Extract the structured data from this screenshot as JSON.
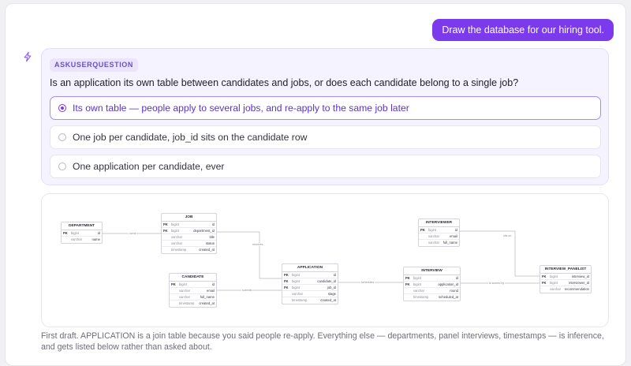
{
  "user_message": "Draw the database for our hiring tool.",
  "question": {
    "tool_label": "ASKUSERQUESTION",
    "text": "Is an application its own table between candidates and jobs, or does each candidate belong to a single job?",
    "options": [
      {
        "label": "Its own table — people apply to several jobs, and re-apply to the same job later",
        "selected": true
      },
      {
        "label": "One job per candidate, job_id sits on the candidate row",
        "selected": false
      },
      {
        "label": "One application per candidate, ever",
        "selected": false
      }
    ]
  },
  "diagram": {
    "tables": {
      "department": {
        "name": "DEPARTMENT",
        "rows": [
          {
            "key": "PK",
            "type": "bigint",
            "field": "id"
          },
          {
            "key": "",
            "type": "varchar",
            "field": "name"
          }
        ]
      },
      "job": {
        "name": "JOB",
        "rows": [
          {
            "key": "PK",
            "type": "bigint",
            "field": "id"
          },
          {
            "key": "FK",
            "type": "bigint",
            "field": "department_id"
          },
          {
            "key": "",
            "type": "varchar",
            "field": "title"
          },
          {
            "key": "",
            "type": "varchar",
            "field": "status"
          },
          {
            "key": "",
            "type": "timestamp",
            "field": "created_at"
          }
        ]
      },
      "candidate": {
        "name": "CANDIDATE",
        "rows": [
          {
            "key": "PK",
            "type": "bigint",
            "field": "id"
          },
          {
            "key": "",
            "type": "varchar",
            "field": "email"
          },
          {
            "key": "",
            "type": "varchar",
            "field": "full_name"
          },
          {
            "key": "",
            "type": "timestamp",
            "field": "created_at"
          }
        ]
      },
      "application": {
        "name": "APPLICATION",
        "rows": [
          {
            "key": "PK",
            "type": "bigint",
            "field": "id"
          },
          {
            "key": "FK",
            "type": "bigint",
            "field": "candidate_id"
          },
          {
            "key": "FK",
            "type": "bigint",
            "field": "job_id"
          },
          {
            "key": "",
            "type": "varchar",
            "field": "stage"
          },
          {
            "key": "",
            "type": "timestamp",
            "field": "created_at"
          }
        ]
      },
      "interviewer": {
        "name": "INTERVIEWER",
        "rows": [
          {
            "key": "PK",
            "type": "bigint",
            "field": "id"
          },
          {
            "key": "",
            "type": "varchar",
            "field": "email"
          },
          {
            "key": "",
            "type": "varchar",
            "field": "full_name"
          }
        ]
      },
      "interview": {
        "name": "INTERVIEW",
        "rows": [
          {
            "key": "PK",
            "type": "bigint",
            "field": "id"
          },
          {
            "key": "FK",
            "type": "bigint",
            "field": "application_id"
          },
          {
            "key": "",
            "type": "varchar",
            "field": "round"
          },
          {
            "key": "",
            "type": "timestamp",
            "field": "scheduled_at"
          }
        ]
      },
      "panelist": {
        "name": "INTERVIEW_PANELIST",
        "rows": [
          {
            "key": "FK",
            "type": "bigint",
            "field": "interview_id"
          },
          {
            "key": "FK",
            "type": "bigint",
            "field": "interviewer_id"
          },
          {
            "key": "",
            "type": "varchar",
            "field": "recommendation"
          }
        ]
      }
    },
    "relations": {
      "dept_job": "owns",
      "job_app": "receives",
      "cand_app": "submits",
      "app_interview": "schedules",
      "interview_panel": "is scored by",
      "interviewer_panel": "sits on"
    }
  },
  "caption": "First draft. APPLICATION is a join table because you said people re-apply. Everything else — departments, panel interviews, timestamps — is inference, and gets listed below rather than asked about."
}
